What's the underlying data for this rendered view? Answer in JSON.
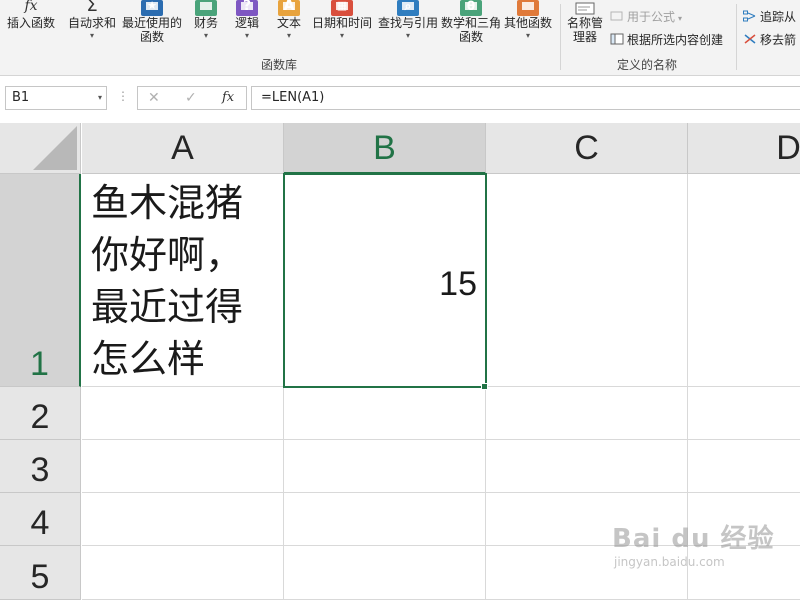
{
  "ribbon": {
    "buttons": [
      {
        "label": "插入函数",
        "icon": "fx-icon",
        "icon_text": "fx",
        "color": "#3a3a3a",
        "caret": ""
      },
      {
        "label": "自动求和",
        "icon": "sigma-icon",
        "icon_text": "Σ",
        "color": "#3a3a3a",
        "caret": "▾"
      },
      {
        "label": "最近使用的函数",
        "icon": "star-book-icon",
        "icon_text": "★",
        "color": "#2b6cb0",
        "caret": "▾"
      },
      {
        "label": "财务",
        "icon": "finance-book-icon",
        "icon_text": "",
        "color": "#4aa37a",
        "caret": "▾"
      },
      {
        "label": "逻辑",
        "icon": "logic-book-icon",
        "icon_text": "?",
        "color": "#7e57c2",
        "caret": "▾"
      },
      {
        "label": "文本",
        "icon": "text-book-icon",
        "icon_text": "A",
        "color": "#e8a33d",
        "caret": "▾"
      },
      {
        "label": "日期和时间",
        "icon": "calendar-book-icon",
        "icon_text": "▦",
        "color": "#d94f3d",
        "caret": "▾"
      },
      {
        "label": "查找与引用",
        "icon": "lookup-book-icon",
        "icon_text": "⌕",
        "color": "#2f7dbf",
        "caret": "▾"
      },
      {
        "label": "数学和三角函数",
        "icon": "math-book-icon",
        "icon_text": "θ",
        "color": "#4aa37a",
        "caret": "▾"
      },
      {
        "label": "其他函数",
        "icon": "more-book-icon",
        "icon_text": "",
        "color": "#e07a3a",
        "caret": "▾"
      }
    ],
    "group1_label": "函数库",
    "name_manager": "名称管理器",
    "use_in_formula": "用于公式",
    "create_from_selection": "根据所选内容创建",
    "group2_label": "定义的名称",
    "trace_precedents": "追踪从",
    "remove_arrows": "移去箭"
  },
  "formula_bar": {
    "name_box": "B1",
    "cancel_icon": "✕",
    "enter_icon": "✓",
    "fx_label": "fx",
    "formula": "=LEN(A1)"
  },
  "grid": {
    "columns": [
      "A",
      "B",
      "C",
      "D"
    ],
    "rows": [
      "1",
      "2",
      "3",
      "4",
      "5"
    ],
    "cells": {
      "A1": "鱼木混猪\n你好啊，\n最近过得\n怎么样",
      "B1": "15"
    },
    "selected_cell": "B1",
    "accent_color": "#217346"
  },
  "watermark": {
    "brand": "Bai du 经验",
    "url": "jingyan.baidu.com"
  }
}
